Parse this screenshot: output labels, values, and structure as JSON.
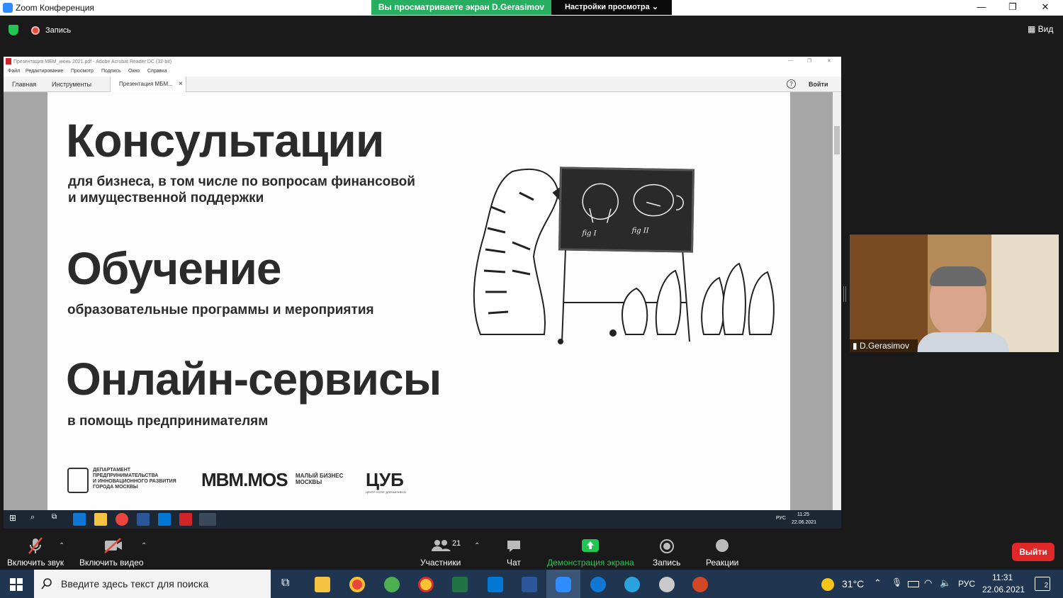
{
  "zoom_window": {
    "title": "Zoom Конференция",
    "share_banner": "Вы просматриваете экран D.Gerasimov",
    "view_settings": "Настройки просмотра",
    "view_settings_caret": "⌄",
    "recording_label": "Запись",
    "view_label": "Вид",
    "minimize": "—",
    "restore": "❐",
    "close": "✕"
  },
  "shared_screen": {
    "acrobat": {
      "title": "Презентация МБМ_июнь 2021.pdf - Adobe Acrobat Reader DC (32-bit)",
      "menu": [
        "Файл",
        "Редактирование",
        "Просмотр",
        "Подпись",
        "Окно",
        "Справка"
      ],
      "tabs": [
        "Главная",
        "Инструменты"
      ],
      "doc_tab": "Презентация МБМ...",
      "doc_tab_close": "×",
      "help": "?",
      "signin": "Войти"
    },
    "slide": {
      "heading1": "Консультации",
      "sub1_line1": "для бизнеса, в том числе по вопросам финансовой",
      "sub1_line2": "и имущественной поддержки",
      "heading2": "Обучение",
      "sub2": "образовательные программы и мероприятия",
      "heading3": "Онлайн-сервисы",
      "sub3": "в помощь предпринимателям",
      "logo1_lines": [
        "ДЕПАРТАМЕНТ",
        "ПРЕДПРИНИМАТЕЛЬСТВА",
        "И ИННОВАЦИОННОГО РАЗВИТИЯ",
        "ГОРОДА МОСКВЫ"
      ],
      "logo2_main": "MBM.MOS",
      "logo2_sub_line1": "МАЛЫЙ БИЗНЕС",
      "logo2_sub_line2": "МОСКВЫ",
      "logo3_main": "ЦУБ",
      "logo3_sub": "ЦЕНТР УСЛУГ ДЛЯ БИЗНЕСА",
      "board_fig1": "fig I",
      "board_fig2": "fig II"
    },
    "inner_taskbar": {
      "lang": "РУС",
      "time": "11:25",
      "date": "22.06.2021"
    }
  },
  "video": {
    "participant_name": "D.Gerasimov"
  },
  "controls": {
    "mute_label": "Включить звук",
    "video_label": "Включить видео",
    "participants_label": "Участники",
    "participants_count": "21",
    "chat_label": "Чат",
    "share_label": "Демонстрация экрана",
    "record_label": "Запись",
    "reactions_label": "Реакции",
    "leave_label": "Выйти"
  },
  "windows_taskbar": {
    "search_placeholder": "Введите здесь текст для поиска",
    "weather": "31°C",
    "lang": "РУС",
    "time": "11:31",
    "date": "22.06.2021",
    "notifications": "2"
  },
  "colors": {
    "zoom_green": "#27ae60",
    "leave_red": "#e02828",
    "taskbar_blue": "#1f3550"
  }
}
